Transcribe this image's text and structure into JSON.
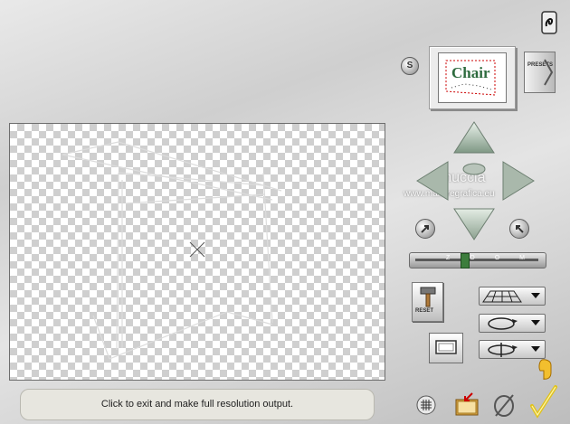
{
  "thumbnail": {
    "text": "Chair"
  },
  "presets_button": {
    "label": "PRESETS"
  },
  "s_button": {
    "label": "S"
  },
  "watermark": {
    "line1": "Pinuccia",
    "line2": "www.maidiregrafica.eu"
  },
  "zoom": {
    "label": "ZOOM"
  },
  "reset_button": {
    "label": "RESET"
  },
  "status": {
    "text": "Click to exit and make full resolution output."
  },
  "icons": [
    "info-icon",
    "grid-icon",
    "save-icon",
    "cancel-icon",
    "ok-icon",
    "hand-icon",
    "hammer-icon"
  ],
  "colors": {
    "accent_green": "#2d6b3e",
    "ok_yellow": "#f0d02a"
  }
}
